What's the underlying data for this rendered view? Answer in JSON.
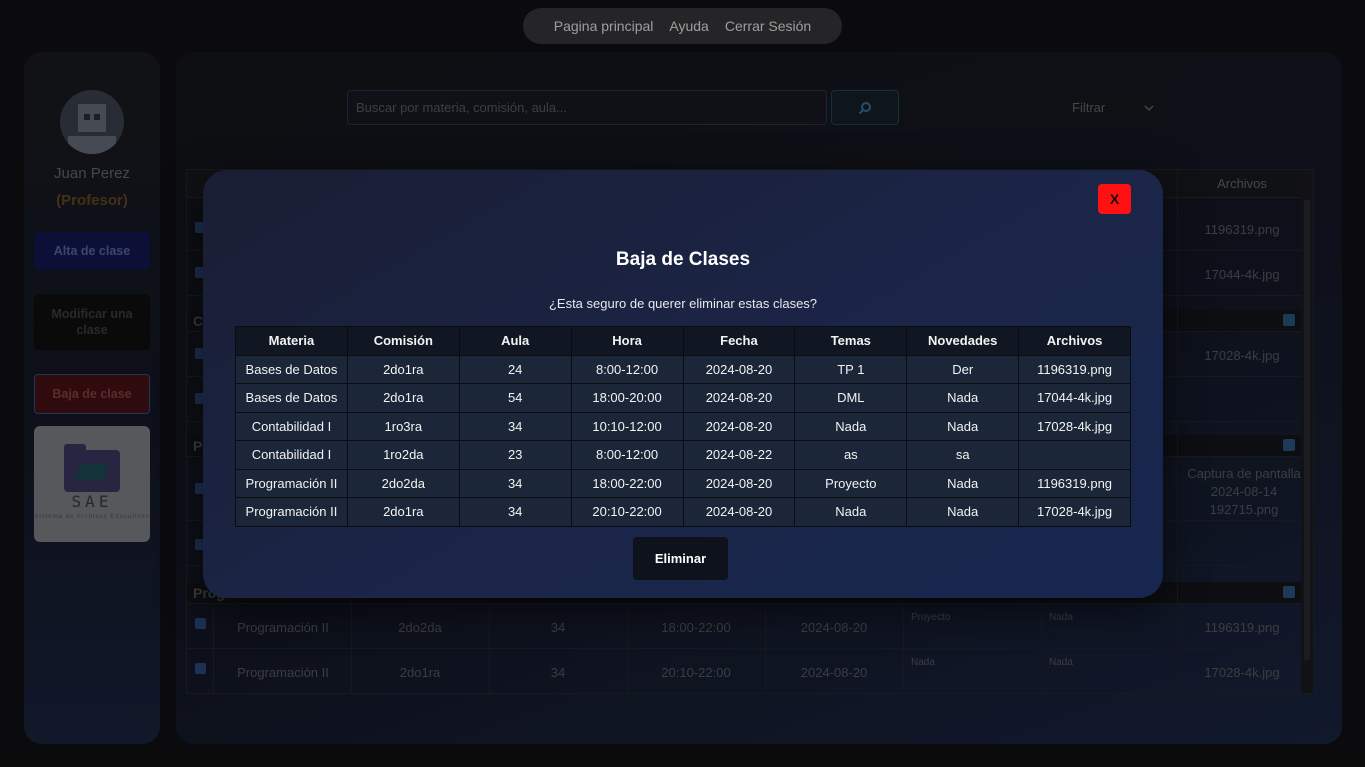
{
  "nav": {
    "items": [
      "Pagina principal",
      "Ayuda",
      "Cerrar Sesión"
    ]
  },
  "sidebar": {
    "user_name": "Juan Perez",
    "user_role": "(Profesor)",
    "buttons": {
      "alta": "Alta de clase",
      "modificar": "Modificar una clase",
      "baja": "Baja de clase"
    },
    "logo": {
      "text": "SAE",
      "tagline": "Sistema de Archivos Educativos"
    }
  },
  "search": {
    "placeholder": "Buscar por materia, comisión, aula...",
    "icon": "search-icon"
  },
  "filter": {
    "label": "Filtrar"
  },
  "background_table": {
    "header_archivos": "Archivos",
    "groups": [
      "C",
      "P",
      "Prog"
    ],
    "rows_top": [
      {
        "archivo": "1196319.png"
      },
      {
        "archivo": "17044-4k.jpg"
      }
    ],
    "rows_c": [
      {
        "archivo": "17028-4k.jpg"
      },
      {
        "archivo": ""
      }
    ],
    "rows_p": [
      {
        "archivo": "Captura de pantalla 2024-08-14 192715.png"
      },
      {
        "archivo": ""
      }
    ],
    "rows_prog": [
      {
        "materia": "Programación II",
        "comision": "2do2da",
        "aula": "34",
        "hora": "18:00-22:00",
        "fecha": "2024-08-20",
        "temas": "Proyecto",
        "novedades": "Nada",
        "archivo": "1196319.png"
      },
      {
        "materia": "Programación II",
        "comision": "2do1ra",
        "aula": "34",
        "hora": "20:10-22:00",
        "fecha": "2024-08-20",
        "temas": "Nada",
        "novedades": "Nada",
        "archivo": "17028-4k.jpg"
      }
    ]
  },
  "modal": {
    "close_label": "X",
    "title": "Baja de Clases",
    "question": "¿Esta seguro de querer eliminar estas clases?",
    "columns": [
      "Materia",
      "Comisión",
      "Aula",
      "Hora",
      "Fecha",
      "Temas",
      "Novedades",
      "Archivos"
    ],
    "rows": [
      [
        "Bases de Datos",
        "2do1ra",
        "24",
        "8:00-12:00",
        "2024-08-20",
        "TP 1",
        "Der",
        "1196319.png"
      ],
      [
        "Bases de Datos",
        "2do1ra",
        "54",
        "18:00-20:00",
        "2024-08-20",
        "DML",
        "Nada",
        "17044-4k.jpg"
      ],
      [
        "Contabilidad I",
        "1ro3ra",
        "34",
        "10:10-12:00",
        "2024-08-20",
        "Nada",
        "Nada",
        "17028-4k.jpg"
      ],
      [
        "Contabilidad I",
        "1ro2da",
        "23",
        "8:00-12:00",
        "2024-08-22",
        "as",
        "sa",
        ""
      ],
      [
        "Programación II",
        "2do2da",
        "34",
        "18:00-22:00",
        "2024-08-20",
        "Proyecto",
        "Nada",
        "1196319.png"
      ],
      [
        "Programación II",
        "2do1ra",
        "34",
        "20:10-22:00",
        "2024-08-20",
        "Nada",
        "Nada",
        "17028-4k.jpg"
      ]
    ],
    "delete_label": "Eliminar"
  }
}
